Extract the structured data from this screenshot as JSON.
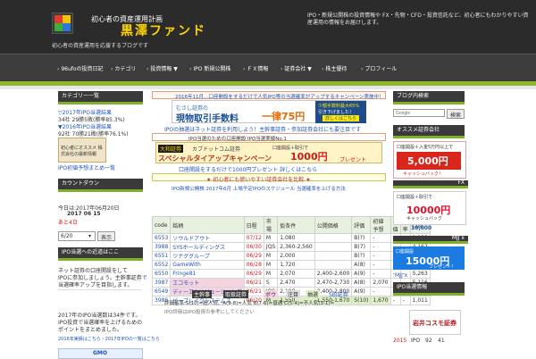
{
  "header": {
    "tagline": "初心者の資産運用計画",
    "title": "黒澤ファンド",
    "desc": "初心者の資産運用を応援するブログです",
    "right_desc": "IPO・新規公開株の投資情報や FX・先物・CFD・投資信託など、初心者にもわかりやすい資産運用の情報をお届けします。"
  },
  "nav": [
    "96ufoの投資日記",
    "カテゴリ",
    "投資情報 ▼",
    "IPO 新規公開株",
    "ＦＸ情報",
    "証券会社 ▼",
    "株主優待",
    "プロフィール"
  ],
  "left": {
    "w1": {
      "title": "カテゴリー一覧",
      "lines": [
        "▽2017年IPO当選結果",
        "34社 29勝5敗(勝率85.3%)",
        "▼2016年IPO当選結果",
        "92社 70勝21敗(勝率76.1%)"
      ],
      "ad": "初心者にオススメ 株式会社の最新情報",
      "link": "IPO初値予想まとめ一覧"
    },
    "w2": {
      "title": "カウントダウン",
      "lines": [
        "今日は:2017年06月20日",
        "2017 06 15",
        "あと4日"
      ],
      "select": "6/20",
      "btn": "表示"
    },
    "w3": {
      "title": "IPO当選への近道はここ",
      "lines": [
        "ネット証券の口座開設をして",
        "IPOに参加しましょう。主幹事証券で",
        "当選確率アップを目指します。"
      ],
      "lines2": [
        "2017年のIPO当選数は34件です。",
        "IPO投資で当選確率を上げるための",
        "ポイントをまとめました。",
        "2016年実績はこちら・2017年IPOの一覧はこちら"
      ],
      "gmo": "GMO"
    }
  },
  "right": {
    "w1": {
      "title": "ブログ内検索",
      "placeholder": "Google",
      "btn": "検索"
    },
    "w2": {
      "title": "オススメ証券会社"
    },
    "ad1": {
      "lines": [
        "口座開設＋入金5万円以上で",
        "5,000円",
        "キャッシュバック！"
      ]
    },
    "fx": "FX",
    "ad2": {
      "lines": [
        "口座開設＋取引で",
        "10000円",
        "キャッシュバック"
      ]
    },
    "ad2_amount": "10,000",
    "w3label": "MJJ x",
    "ad3": {
      "lines": [
        "口座開設",
        "15000円",
        "プレゼント！"
      ]
    },
    "w3": {
      "title": "IPO当選情報"
    },
    "ad4": {
      "lines": [
        "岩井コスモ証券"
      ]
    },
    "foot": [
      "2015",
      "IPO",
      "92",
      "41"
    ]
  },
  "main": {
    "notice1": "2016年11月…口座開設をするだけで人気IPO等の当選確率がアップするキャンペーン実施中！",
    "banner1": {
      "brand": "むさし証券の",
      "main": "現物取引手数料",
      "price": "一律75円",
      "side": [
        "少額手数料最大65%",
        "引き下げました！",
        "詳しくはこちら"
      ]
    },
    "notice2": "IPOの抽選はネット証券を利用しよう！主幹事証券・参加証券会社にも要注目です",
    "notice3": "IPO当選のための口座開設 IPO当選実績No.1",
    "banner2": {
      "brand": "大和証券",
      "sub": "カブドットコム証券",
      "main": "スペシャルタイアップキャンペーン",
      "price": "1000円",
      "side": [
        "口座開設＋取引で",
        "プレゼント"
      ]
    },
    "notice4": "口座開設をするだけで1000円プレゼント 詳しくはこちら",
    "notice5": "★ 初心者にも使いやすい証券会社を比較 ★",
    "notice6": "IPO新規公開株 2017年6月 上場予定IPOのスケジュール 当選確率を上げる方法",
    "table": {
      "headers": [
        "code",
        "銘柄",
        "日程",
        "市場",
        "仮条件",
        "公開価格",
        "評価",
        "初値予想",
        "初値",
        "倍率",
        "口数"
      ],
      "rows": [
        [
          "6553",
          "ソウルドアウト",
          "07/12",
          "M",
          "1,080",
          "",
          "B(?)",
          "-",
          "-",
          "-",
          "1,189"
        ],
        [
          "3988",
          "SYSホールディングス",
          "06/30",
          "JQS",
          "2,360-2,560",
          "",
          "B(7)",
          "-",
          "-",
          "-",
          "4,162"
        ],
        [
          "6551",
          "ツナググループ",
          "06/29",
          "M",
          "2,000",
          "",
          "B(?)",
          "-",
          "-",
          "-",
          "2,440"
        ],
        [
          "6552",
          "GameWith",
          "06/28",
          "M",
          "1,720",
          "",
          "A(8)",
          "-",
          "-",
          "-",
          "3,950"
        ],
        [
          "6550",
          "Fringe81",
          "06/29",
          "M",
          "2,070",
          "2,400-2,600",
          "A(9)",
          "-",
          "-",
          "-",
          "5,263"
        ],
        [
          "3987",
          "エコモット",
          "06/21",
          "S",
          "2,470",
          "2,470-2,730",
          "A(8)",
          "2,070",
          "-",
          "-",
          "5,116"
        ],
        [
          "6549",
          "ディーエムソリューションズ",
          "06/21",
          "JQS",
          "2,190",
          "2,400-2,800",
          "A(9)",
          "-",
          "-",
          "-",
          "6,936"
        ],
        [
          "3986",
          "ビーブレイクシステムズ",
          "06/20",
          "M",
          "1,550",
          "1,550-1,670",
          "S(10)",
          "1,670",
          "-",
          "-",
          "1,011"
        ]
      ]
    },
    "legend": [
      "主幹事",
      "取扱証券",
      "ボウ",
      "注目",
      "抽選",
      "SBI証券"
    ],
    "footnote1": "評価基準:S(10)=超人気、A(9-8)=人気 B(7-6)=普通 C(5-4)=不人気(3-1)=",
    "footnote2": "IPO評価はIPO投資の参考にしてください"
  },
  "colors": {
    "header": "#2b2b2b",
    "accent": "#8fb82e",
    "link": "#2255bb",
    "red": "#cc2222"
  }
}
